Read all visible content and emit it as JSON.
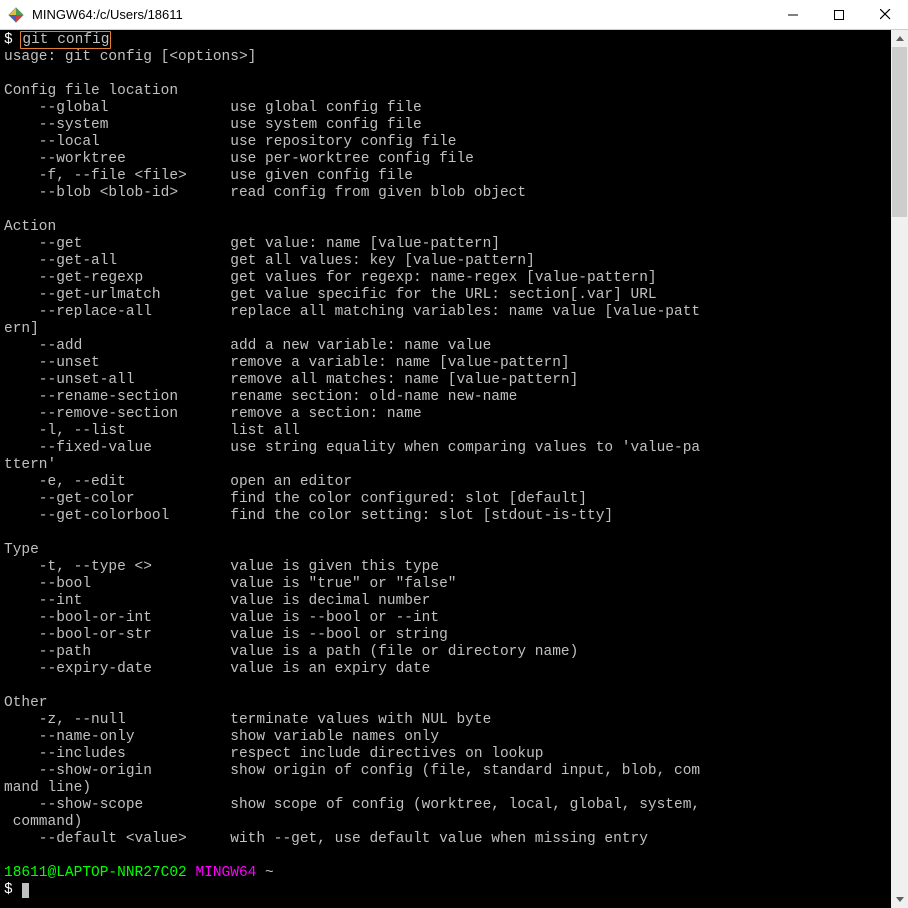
{
  "window": {
    "title": "MINGW64:/c/Users/18611"
  },
  "prompt1_dollar": "$ ",
  "prompt1_cmd": "git config",
  "usage_line": "usage: git config [<options>]",
  "blank": "",
  "sec_config_loc": "Config file location",
  "opt_global": "    --global              use global config file",
  "opt_system": "    --system              use system config file",
  "opt_local": "    --local               use repository config file",
  "opt_worktree": "    --worktree            use per-worktree config file",
  "opt_file": "    -f, --file <file>     use given config file",
  "opt_blob": "    --blob <blob-id>      read config from given blob object",
  "sec_action": "Action",
  "opt_get": "    --get                 get value: name [value-pattern]",
  "opt_get_all": "    --get-all             get all values: key [value-pattern]",
  "opt_get_regexp": "    --get-regexp          get values for regexp: name-regex [value-pattern]",
  "opt_get_urlmatch": "    --get-urlmatch        get value specific for the URL: section[.var] URL",
  "opt_replace_all_a": "    --replace-all         replace all matching variables: name value [value-patt",
  "opt_replace_all_b": "ern]",
  "opt_add": "    --add                 add a new variable: name value",
  "opt_unset": "    --unset               remove a variable: name [value-pattern]",
  "opt_unset_all": "    --unset-all           remove all matches: name [value-pattern]",
  "opt_rename_section": "    --rename-section      rename section: old-name new-name",
  "opt_remove_section": "    --remove-section      remove a section: name",
  "opt_list": "    -l, --list            list all",
  "opt_fixed_value_a": "    --fixed-value         use string equality when comparing values to 'value-pa",
  "opt_fixed_value_b": "ttern'",
  "opt_edit": "    -e, --edit            open an editor",
  "opt_get_color": "    --get-color           find the color configured: slot [default]",
  "opt_get_colorbool": "    --get-colorbool       find the color setting: slot [stdout-is-tty]",
  "sec_type": "Type",
  "opt_type": "    -t, --type <>         value is given this type",
  "opt_bool": "    --bool                value is \"true\" or \"false\"",
  "opt_int": "    --int                 value is decimal number",
  "opt_bool_or_int": "    --bool-or-int         value is --bool or --int",
  "opt_bool_or_str": "    --bool-or-str         value is --bool or string",
  "opt_path": "    --path                value is a path (file or directory name)",
  "opt_expiry": "    --expiry-date         value is an expiry date",
  "sec_other": "Other",
  "opt_null": "    -z, --null            terminate values with NUL byte",
  "opt_name_only": "    --name-only           show variable names only",
  "opt_includes": "    --includes            respect include directives on lookup",
  "opt_show_origin_a": "    --show-origin         show origin of config (file, standard input, blob, com",
  "opt_show_origin_b": "mand line)",
  "opt_show_scope_a": "    --show-scope          show scope of config (worktree, local, global, system,",
  "opt_show_scope_b": " command)",
  "opt_default": "    --default <value>     with --get, use default value when missing entry",
  "prompt2_user": "18611@LAPTOP-NNR27C02",
  "prompt2_sep": " ",
  "prompt2_env": "MINGW64",
  "prompt2_path": " ~",
  "prompt2_dollar": "$ "
}
